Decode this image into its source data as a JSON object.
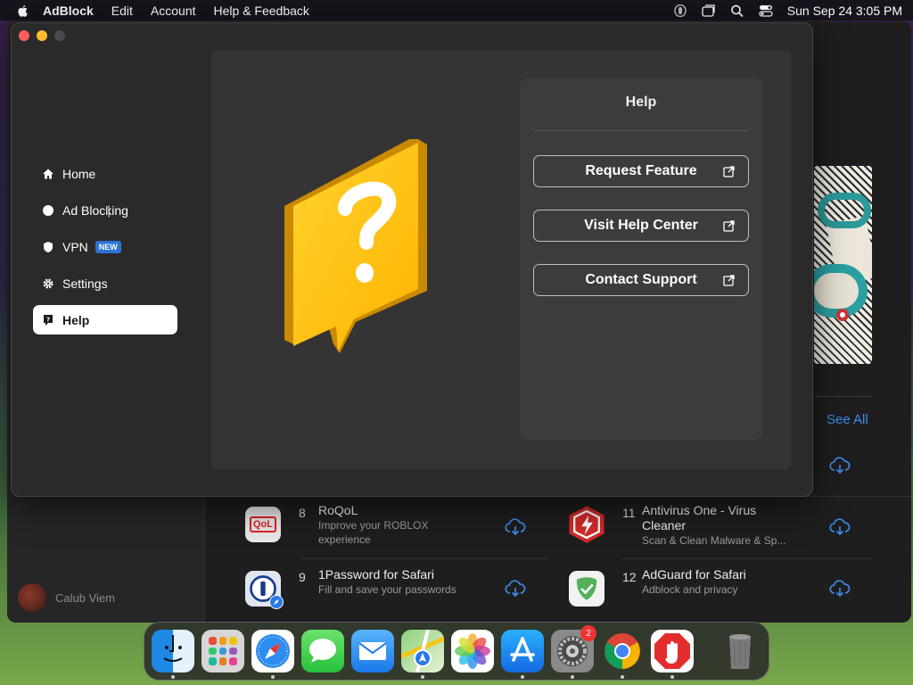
{
  "menubar": {
    "app_name": "AdBlock",
    "items": [
      "Edit",
      "Account",
      "Help & Feedback"
    ],
    "clock": "Sun Sep 24  3:05 PM"
  },
  "sidebar": {
    "items": [
      {
        "label": "Home",
        "icon": "home-icon"
      },
      {
        "label": "Ad Blocking",
        "icon": "circle-icon"
      },
      {
        "label": "VPN",
        "icon": "shield-icon",
        "badge": "NEW"
      },
      {
        "label": "Settings",
        "icon": "gear-icon"
      },
      {
        "label": "Help",
        "icon": "help-icon",
        "active": true
      }
    ]
  },
  "help_panel": {
    "title": "Help",
    "buttons": [
      "Request Feature",
      "Visit Help Center",
      "Contact Support"
    ]
  },
  "store": {
    "see_all": "See All",
    "user_name": "Calub Viem",
    "apps": [
      {
        "num": "8",
        "title": "RoQoL",
        "subtitle": "Improve your ROBLOX experience",
        "icon_text": "QoL"
      },
      {
        "num": "9",
        "title": "1Password for Safari",
        "subtitle": "Fill and save your passwords"
      },
      {
        "num": "11",
        "title": "Antivirus One - Virus Cleaner",
        "subtitle": "Scan & Clean Malware & Sp..."
      },
      {
        "num": "12",
        "title": "AdGuard for Safari",
        "subtitle": "Adblock and privacy"
      }
    ]
  },
  "dock": {
    "apps": [
      "finder-icon",
      "launchpad-icon",
      "safari-icon",
      "messages-icon",
      "mail-icon",
      "maps-icon",
      "photos-icon",
      "app-store-icon",
      "system-settings-icon",
      "chrome-icon",
      "adblock-icon",
      "trash-icon"
    ],
    "settings_badge": "2"
  },
  "colors": {
    "accent_blue": "#3d8ef0",
    "question_yellow": "#ffbf00",
    "new_badge": "#2c73d6"
  }
}
